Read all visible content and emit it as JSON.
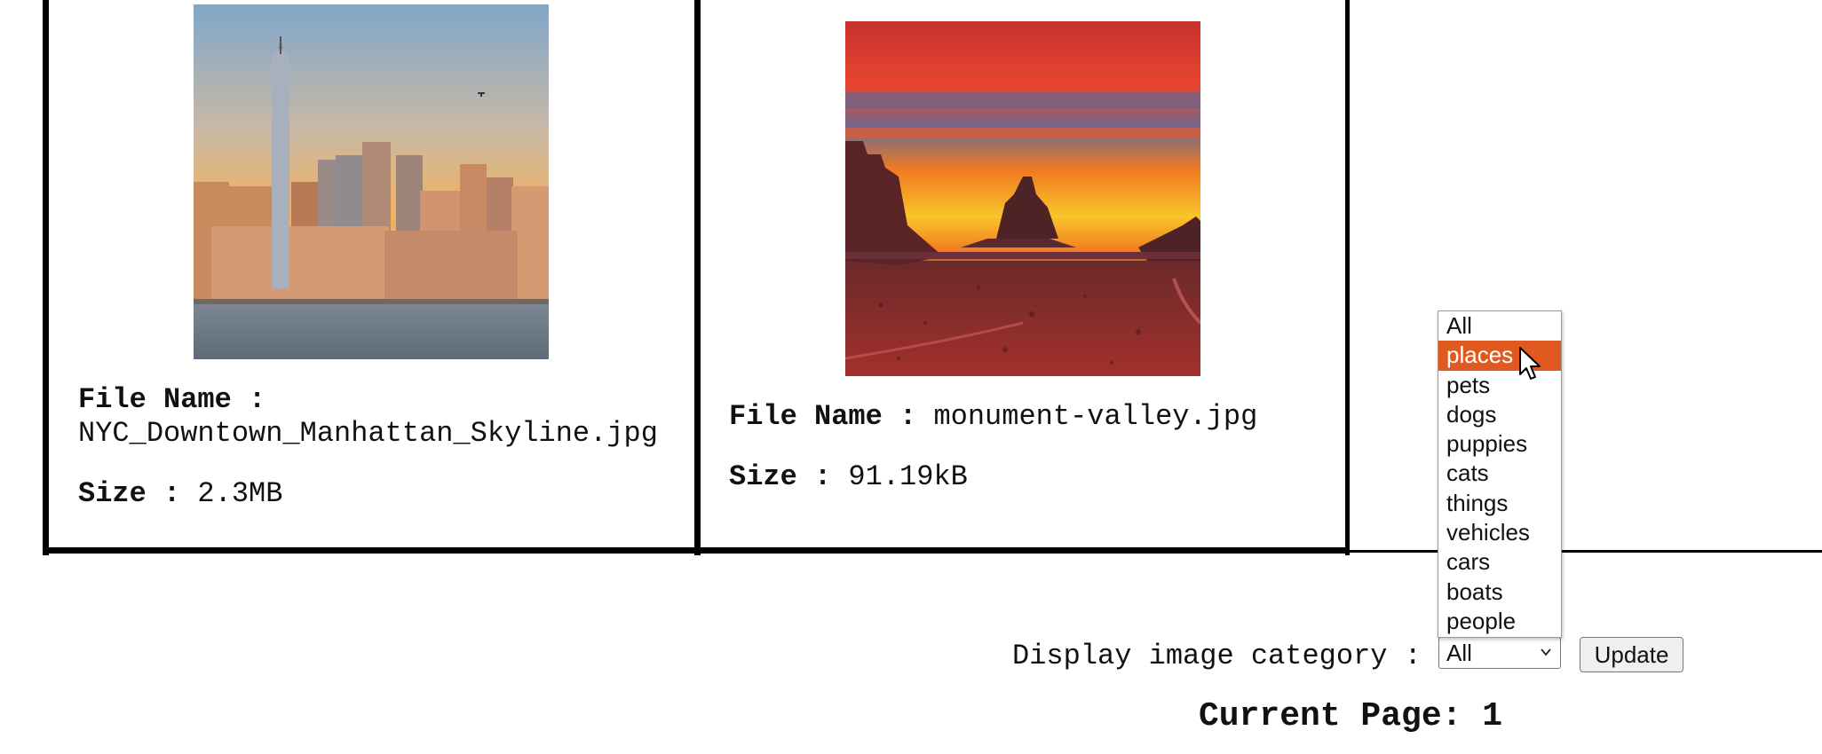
{
  "gallery": {
    "items": [
      {
        "file_name_label": "File Name :",
        "file_name": "NYC_Downtown_Manhattan_Skyline.jpg",
        "size_label": "Size :",
        "size": "2.3MB",
        "image_alt": "Manhattan skyline at sunset"
      },
      {
        "file_name_label": "File Name :",
        "file_name": "monument-valley.jpg",
        "size_label": "Size :",
        "size": "91.19kB",
        "image_alt": "Monument Valley at sunset"
      }
    ]
  },
  "filter": {
    "label": "Display image category :",
    "selected": "All",
    "options": [
      "All",
      "places",
      "pets",
      "dogs",
      "puppies",
      "cats",
      "things",
      "vehicles",
      "cars",
      "boats",
      "people"
    ],
    "highlighted": "places",
    "update_label": "Update"
  },
  "pagination": {
    "current_page_text": "Current Page: 1"
  },
  "colors": {
    "highlight": "#e05a1f",
    "border": "#000000"
  }
}
